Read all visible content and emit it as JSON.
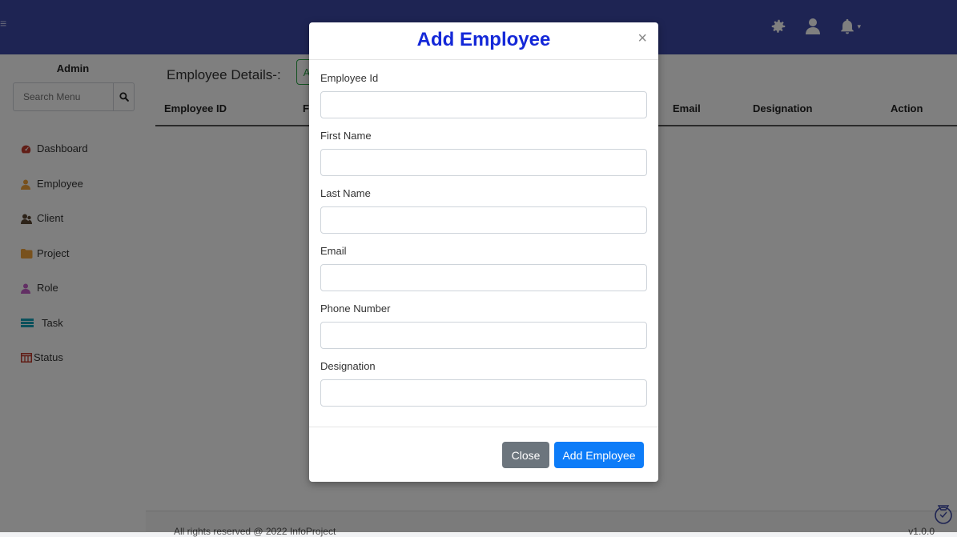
{
  "header": {
    "menu_glyph": "≡",
    "icons": [
      "gear-icon",
      "user-icon",
      "bell-icon"
    ],
    "bell_caret": "▾"
  },
  "sidebar": {
    "title": "Admin",
    "search_placeholder": "Search Menu",
    "items": [
      {
        "label": "Dashboard",
        "icon": "dashboard-icon",
        "color": "#c23c2f"
      },
      {
        "label": "Employee",
        "icon": "employee-icon",
        "color": "#f0a23a"
      },
      {
        "label": "Client",
        "icon": "client-icon",
        "color": "#5b4632"
      },
      {
        "label": "Project",
        "icon": "folder-icon",
        "color": "#f0a23a"
      },
      {
        "label": "Role",
        "icon": "role-icon",
        "color": "#c45ec9"
      },
      {
        "label": "Task",
        "icon": "task-icon",
        "color": "#17a2b8"
      },
      {
        "label": "Status",
        "icon": "status-icon",
        "color": "#c0392b"
      }
    ]
  },
  "main": {
    "title": "Employee Details-:",
    "add_button_label": "A",
    "columns": [
      "Employee ID",
      "Fi",
      "Email",
      "Designation",
      "Action"
    ]
  },
  "footer": {
    "text": "All rights reserved @ 2022 InfoProject",
    "version": "v1.0.0"
  },
  "modal": {
    "title": "Add Employee",
    "close_glyph": "×",
    "fields": [
      {
        "label": "Employee Id",
        "value": ""
      },
      {
        "label": "First Name",
        "value": ""
      },
      {
        "label": "Last Name",
        "value": ""
      },
      {
        "label": "Email",
        "value": ""
      },
      {
        "label": "Phone Number",
        "value": ""
      },
      {
        "label": "Designation",
        "value": ""
      }
    ],
    "close_button": "Close",
    "submit_button": "Add Employee"
  },
  "colors": {
    "header_bg": "#3d49a6",
    "modal_title": "#1428d8",
    "primary": "#0d7cf8",
    "secondary": "#6c757d",
    "success": "#28a745"
  }
}
